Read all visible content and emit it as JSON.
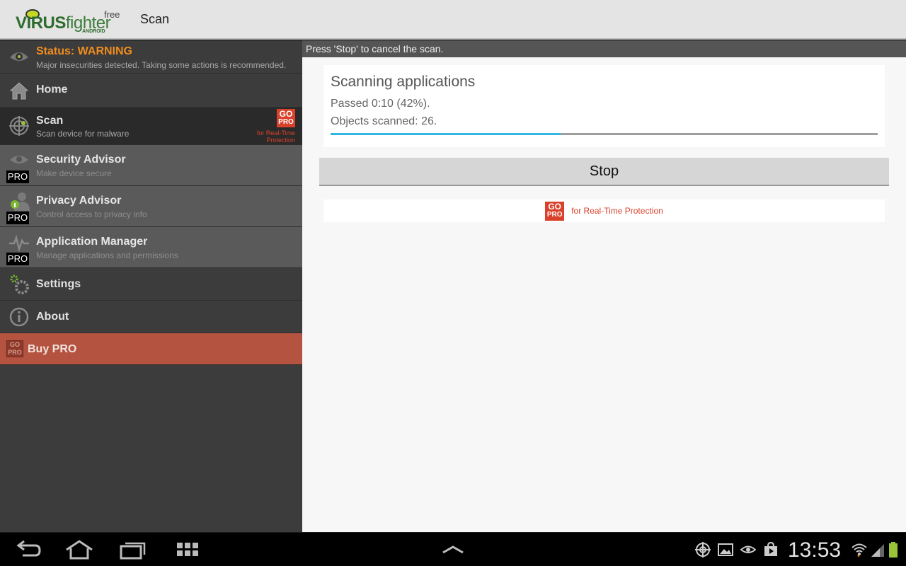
{
  "header": {
    "logo_word_virus": "VIRUS",
    "logo_word_fighter": "fighter",
    "logo_free": "free",
    "logo_android": "ANDROID",
    "title": "Scan"
  },
  "sidebar": {
    "status": {
      "label": "Status: WARNING",
      "sub": "Major insecurities detected. Taking some actions is recommended."
    },
    "home": {
      "label": "Home"
    },
    "scan": {
      "label": "Scan",
      "sub": "Scan device for malware",
      "badge_go": "GO",
      "badge_pro": "PRO",
      "badge_note": "for Real-Time Protection"
    },
    "security_advisor": {
      "label": "Security Advisor",
      "sub": "Make device secure",
      "tag": "PRO"
    },
    "privacy_advisor": {
      "label": "Privacy Advisor",
      "sub": "Control access to privacy info",
      "tag": "PRO"
    },
    "application_manager": {
      "label": "Application Manager",
      "sub": "Manage applications and permissions",
      "tag": "PRO"
    },
    "settings": {
      "label": "Settings"
    },
    "about": {
      "label": "About"
    },
    "buy_pro": {
      "label": "Buy PRO",
      "badge_go": "GO",
      "badge_pro": "PRO"
    }
  },
  "main": {
    "hint": "Press 'Stop' to cancel the scan.",
    "scan_title": "Scanning applications",
    "passed": "Passed 0:10 (42%).",
    "objects": "Objects scanned: 26.",
    "progress_fraction": 0.42,
    "stop_label": "Stop",
    "promo_go": "GO",
    "promo_pro": "PRO",
    "promo_text": "for Real-Time Protection"
  },
  "system_bar": {
    "clock": "13:53"
  },
  "colors": {
    "status_warning": "#f08d1e",
    "gopro_red": "#d9412b",
    "progress_blue": "#33b5e5",
    "buy_pro_bg": "#b4533f"
  }
}
